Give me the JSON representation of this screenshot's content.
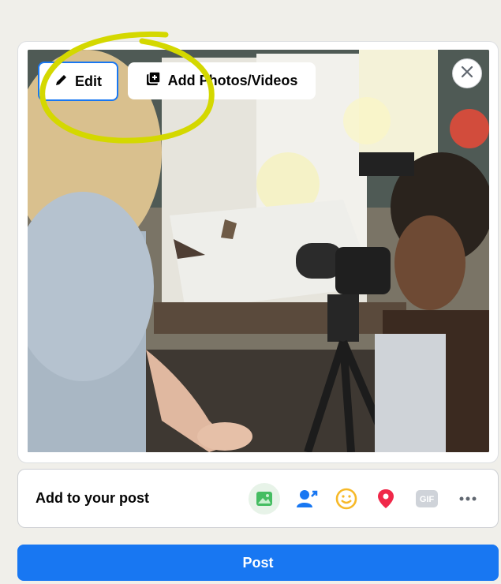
{
  "media": {
    "edit_label": "Edit",
    "add_label": "Add Photos/Videos"
  },
  "add_to_post": {
    "label": "Add to your post",
    "icons": [
      "photo-icon",
      "tag-people-icon",
      "feeling-icon",
      "checkin-icon",
      "gif-icon",
      "more-icon"
    ],
    "gif_text": "GIF"
  },
  "post_button": {
    "label": "Post"
  },
  "colors": {
    "accent": "#1877f2",
    "annotation": "#d4d800",
    "photo_green": "#45bd62",
    "tag_blue": "#1877f2",
    "feeling_yellow": "#f7b928",
    "checkin_red": "#f02849"
  }
}
